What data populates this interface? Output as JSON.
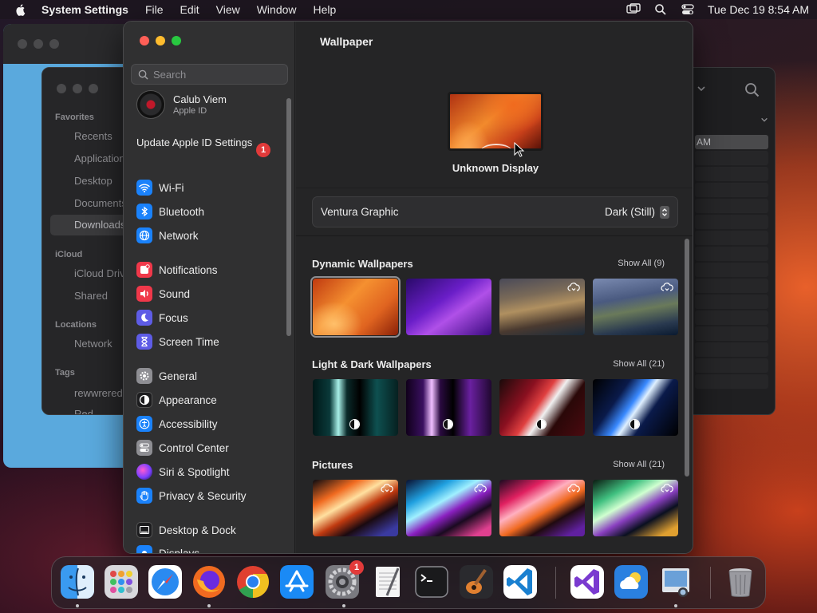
{
  "menubar": {
    "app_name": "System Settings",
    "menus": [
      "File",
      "Edit",
      "View",
      "Window",
      "Help"
    ],
    "datetime": "Tue Dec 19  8:54 AM"
  },
  "finder": {
    "sections": [
      {
        "title": "Favorites",
        "items": [
          "Recents",
          "Applications",
          "Desktop",
          "Documents",
          "Downloads"
        ]
      },
      {
        "title": "iCloud",
        "items": [
          "iCloud Drive",
          "Shared"
        ]
      },
      {
        "title": "Locations",
        "items": [
          "Network"
        ]
      },
      {
        "title": "Tags",
        "items": [
          "rewwrered",
          "Red"
        ]
      }
    ],
    "selected_item": "Downloads",
    "list_selected_text": "AM"
  },
  "sidebar": {
    "search_placeholder": "Search",
    "profile": {
      "name": "Calub Viem",
      "subtitle": "Apple ID"
    },
    "update_text": "Update Apple ID Settings",
    "update_badge": "1",
    "items": [
      {
        "label": "Wi-Fi",
        "icon": "wifi-icon",
        "color": "#1a82fb"
      },
      {
        "label": "Bluetooth",
        "icon": "bluetooth-icon",
        "color": "#1a82fb"
      },
      {
        "label": "Network",
        "icon": "globe-icon",
        "color": "#1a82fb"
      },
      {
        "label": "Notifications",
        "icon": "bell-icon",
        "color": "#f0384a"
      },
      {
        "label": "Sound",
        "icon": "speaker-icon",
        "color": "#f0384a"
      },
      {
        "label": "Focus",
        "icon": "moon-icon",
        "color": "#5e5ce6"
      },
      {
        "label": "Screen Time",
        "icon": "hourglass-icon",
        "color": "#5e5ce6"
      },
      {
        "label": "General",
        "icon": "gear-icon",
        "color": "#8e8e93"
      },
      {
        "label": "Appearance",
        "icon": "appearance-icon",
        "color": "#1c1c1e"
      },
      {
        "label": "Accessibility",
        "icon": "accessibility-icon",
        "color": "#1a82fb"
      },
      {
        "label": "Control Center",
        "icon": "toggles-icon",
        "color": "#8e8e93"
      },
      {
        "label": "Siri & Spotlight",
        "icon": "siri-icon",
        "color": "#b04ae0"
      },
      {
        "label": "Privacy & Security",
        "icon": "hand-icon",
        "color": "#1a82fb"
      },
      {
        "label": "Desktop & Dock",
        "icon": "dock-icon",
        "color": "#1c1c1e"
      },
      {
        "label": "Displays",
        "icon": "display-icon",
        "color": "#1a82fb"
      }
    ]
  },
  "content": {
    "title": "Wallpaper",
    "display_name": "Unknown Display",
    "wallpaper_name": "Ventura Graphic",
    "wallpaper_mode": "Dark (Still)",
    "sections": [
      {
        "title": "Dynamic Wallpapers",
        "show_all": "Show All (9)"
      },
      {
        "title": "Light & Dark Wallpapers",
        "show_all": "Show All (21)"
      },
      {
        "title": "Pictures",
        "show_all": "Show All (21)"
      }
    ]
  },
  "dock": {
    "apps": [
      "finder",
      "launchpad",
      "safari",
      "firefox",
      "chrome",
      "app-store",
      "system-settings",
      "textedit",
      "terminal",
      "garageband",
      "vscode",
      "visual-studio",
      "weather",
      "preview",
      "trash"
    ],
    "system_settings_badge": "1"
  },
  "colors": {
    "accent": "#1a82fb",
    "badge": "#e23a3a"
  }
}
